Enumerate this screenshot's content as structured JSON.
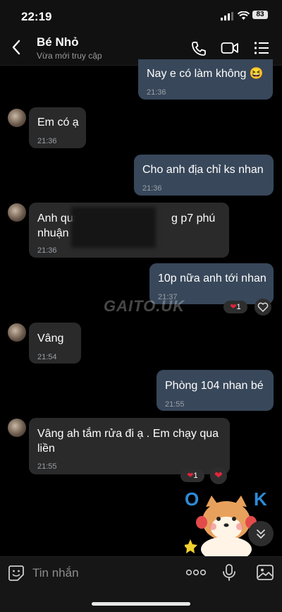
{
  "status_bar": {
    "time": "22:19",
    "battery": "83"
  },
  "header": {
    "name": "Bé Nhỏ",
    "status": "Vừa mới truy cập"
  },
  "messages": [
    {
      "text": "Nay e có làm không 😆",
      "time": "21:36"
    },
    {
      "text": "Em có ạ",
      "time": "21:36"
    },
    {
      "text": "Cho anh địa chỉ ks nhan",
      "time": "21:36"
    },
    {
      "text_line1": "Anh qua",
      "text_line1b": "g p7 phú",
      "text_line2": "nhuận",
      "time": "21:36"
    },
    {
      "text": "10p nữa anh tới nhan",
      "time": "21:37",
      "reaction_count": "1"
    },
    {
      "text": "Vâng",
      "time": "21:54"
    },
    {
      "text": "Phòng 104 nhan bé",
      "time": "21:55"
    },
    {
      "text_line1": "Vâng ah tắm rửa đi ạ . Em chạy qua",
      "text_line2": "liền",
      "time": "21:55",
      "reaction_count": "1"
    }
  ],
  "watermark": "GAITO.UK",
  "sticker": {
    "letters": [
      "O",
      "K"
    ]
  },
  "composer": {
    "placeholder": "Tin nhắn"
  },
  "colors": {
    "outgoing": "#38475a",
    "incoming": "#2a2a2a",
    "heart": "#e0263c"
  }
}
